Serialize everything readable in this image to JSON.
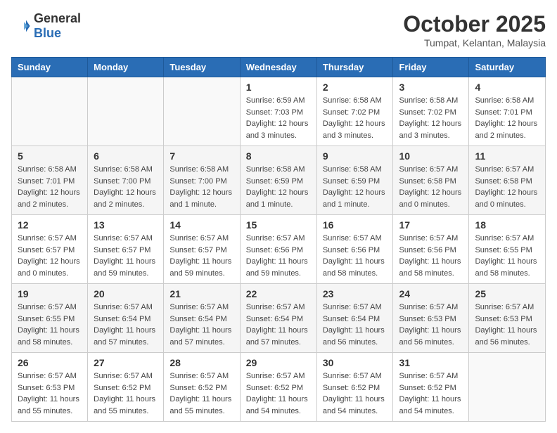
{
  "header": {
    "logo_general": "General",
    "logo_blue": "Blue",
    "title": "October 2025",
    "subtitle": "Tumpat, Kelantan, Malaysia"
  },
  "days_of_week": [
    "Sunday",
    "Monday",
    "Tuesday",
    "Wednesday",
    "Thursday",
    "Friday",
    "Saturday"
  ],
  "weeks": [
    [
      {
        "day": "",
        "info": ""
      },
      {
        "day": "",
        "info": ""
      },
      {
        "day": "",
        "info": ""
      },
      {
        "day": "1",
        "info": "Sunrise: 6:59 AM\nSunset: 7:03 PM\nDaylight: 12 hours\nand 3 minutes."
      },
      {
        "day": "2",
        "info": "Sunrise: 6:58 AM\nSunset: 7:02 PM\nDaylight: 12 hours\nand 3 minutes."
      },
      {
        "day": "3",
        "info": "Sunrise: 6:58 AM\nSunset: 7:02 PM\nDaylight: 12 hours\nand 3 minutes."
      },
      {
        "day": "4",
        "info": "Sunrise: 6:58 AM\nSunset: 7:01 PM\nDaylight: 12 hours\nand 2 minutes."
      }
    ],
    [
      {
        "day": "5",
        "info": "Sunrise: 6:58 AM\nSunset: 7:01 PM\nDaylight: 12 hours\nand 2 minutes."
      },
      {
        "day": "6",
        "info": "Sunrise: 6:58 AM\nSunset: 7:00 PM\nDaylight: 12 hours\nand 2 minutes."
      },
      {
        "day": "7",
        "info": "Sunrise: 6:58 AM\nSunset: 7:00 PM\nDaylight: 12 hours\nand 1 minute."
      },
      {
        "day": "8",
        "info": "Sunrise: 6:58 AM\nSunset: 6:59 PM\nDaylight: 12 hours\nand 1 minute."
      },
      {
        "day": "9",
        "info": "Sunrise: 6:58 AM\nSunset: 6:59 PM\nDaylight: 12 hours\nand 1 minute."
      },
      {
        "day": "10",
        "info": "Sunrise: 6:57 AM\nSunset: 6:58 PM\nDaylight: 12 hours\nand 0 minutes."
      },
      {
        "day": "11",
        "info": "Sunrise: 6:57 AM\nSunset: 6:58 PM\nDaylight: 12 hours\nand 0 minutes."
      }
    ],
    [
      {
        "day": "12",
        "info": "Sunrise: 6:57 AM\nSunset: 6:57 PM\nDaylight: 12 hours\nand 0 minutes."
      },
      {
        "day": "13",
        "info": "Sunrise: 6:57 AM\nSunset: 6:57 PM\nDaylight: 11 hours\nand 59 minutes."
      },
      {
        "day": "14",
        "info": "Sunrise: 6:57 AM\nSunset: 6:57 PM\nDaylight: 11 hours\nand 59 minutes."
      },
      {
        "day": "15",
        "info": "Sunrise: 6:57 AM\nSunset: 6:56 PM\nDaylight: 11 hours\nand 59 minutes."
      },
      {
        "day": "16",
        "info": "Sunrise: 6:57 AM\nSunset: 6:56 PM\nDaylight: 11 hours\nand 58 minutes."
      },
      {
        "day": "17",
        "info": "Sunrise: 6:57 AM\nSunset: 6:56 PM\nDaylight: 11 hours\nand 58 minutes."
      },
      {
        "day": "18",
        "info": "Sunrise: 6:57 AM\nSunset: 6:55 PM\nDaylight: 11 hours\nand 58 minutes."
      }
    ],
    [
      {
        "day": "19",
        "info": "Sunrise: 6:57 AM\nSunset: 6:55 PM\nDaylight: 11 hours\nand 58 minutes."
      },
      {
        "day": "20",
        "info": "Sunrise: 6:57 AM\nSunset: 6:54 PM\nDaylight: 11 hours\nand 57 minutes."
      },
      {
        "day": "21",
        "info": "Sunrise: 6:57 AM\nSunset: 6:54 PM\nDaylight: 11 hours\nand 57 minutes."
      },
      {
        "day": "22",
        "info": "Sunrise: 6:57 AM\nSunset: 6:54 PM\nDaylight: 11 hours\nand 57 minutes."
      },
      {
        "day": "23",
        "info": "Sunrise: 6:57 AM\nSunset: 6:54 PM\nDaylight: 11 hours\nand 56 minutes."
      },
      {
        "day": "24",
        "info": "Sunrise: 6:57 AM\nSunset: 6:53 PM\nDaylight: 11 hours\nand 56 minutes."
      },
      {
        "day": "25",
        "info": "Sunrise: 6:57 AM\nSunset: 6:53 PM\nDaylight: 11 hours\nand 56 minutes."
      }
    ],
    [
      {
        "day": "26",
        "info": "Sunrise: 6:57 AM\nSunset: 6:53 PM\nDaylight: 11 hours\nand 55 minutes."
      },
      {
        "day": "27",
        "info": "Sunrise: 6:57 AM\nSunset: 6:52 PM\nDaylight: 11 hours\nand 55 minutes."
      },
      {
        "day": "28",
        "info": "Sunrise: 6:57 AM\nSunset: 6:52 PM\nDaylight: 11 hours\nand 55 minutes."
      },
      {
        "day": "29",
        "info": "Sunrise: 6:57 AM\nSunset: 6:52 PM\nDaylight: 11 hours\nand 54 minutes."
      },
      {
        "day": "30",
        "info": "Sunrise: 6:57 AM\nSunset: 6:52 PM\nDaylight: 11 hours\nand 54 minutes."
      },
      {
        "day": "31",
        "info": "Sunrise: 6:57 AM\nSunset: 6:52 PM\nDaylight: 11 hours\nand 54 minutes."
      },
      {
        "day": "",
        "info": ""
      }
    ]
  ]
}
